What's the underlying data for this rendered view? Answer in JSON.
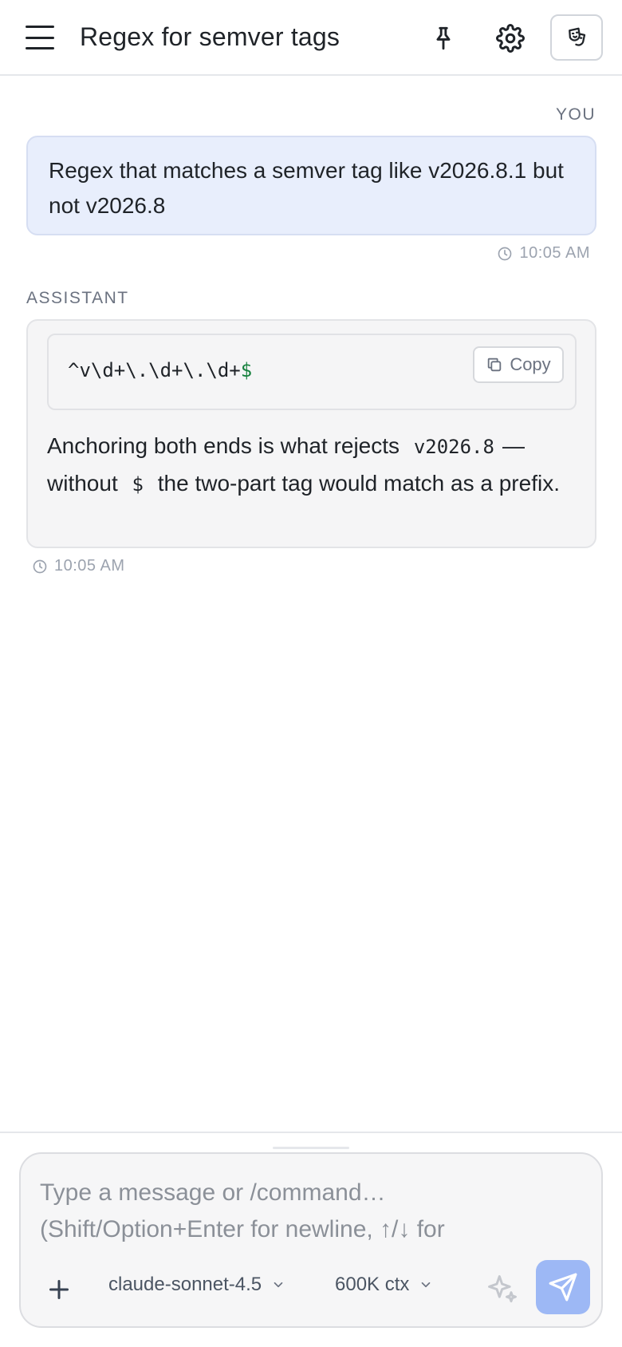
{
  "header": {
    "title": "Regex for semver tags",
    "icons": {
      "menu": "hamburger-menu-icon",
      "pin": "pin-icon",
      "settings": "gear-icon",
      "persona": "theater-mask-icon"
    }
  },
  "messages": [
    {
      "role_label": "YOU",
      "text": "Regex that matches a semver tag like v2026.8.1 but not v2026.8",
      "time": "10:05 AM"
    },
    {
      "role_label": "ASSISTANT",
      "code": {
        "pattern": "^v\\d+\\.\\d+\\.\\d+",
        "anchor": "$",
        "copy_label": "Copy"
      },
      "answer": {
        "part1": "Anchoring both ends is what rejects",
        "code1": "v2026.8",
        "part2": "— without",
        "code2": "$",
        "part3": "the two-part tag would match as a prefix."
      },
      "time": "10:05 AM"
    }
  ],
  "composer": {
    "placeholder": "Type a message or /command… (Shift/Option+Enter for newline, ↑/↓ for",
    "model": "claude-sonnet-4.5",
    "context": "600K ctx"
  },
  "colors": {
    "accent_send": "#9db8f5",
    "user_bubble": "#e8eefc",
    "code_anchor": "#15803d"
  }
}
